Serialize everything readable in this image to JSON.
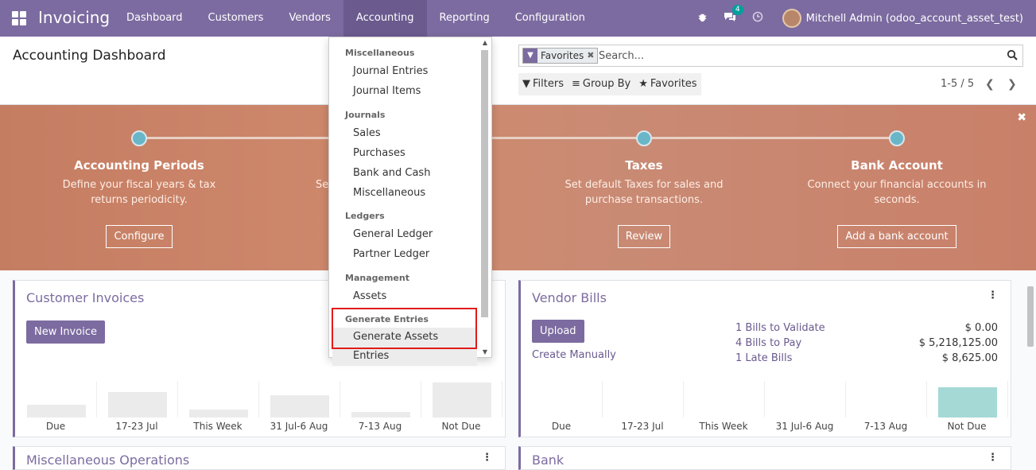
{
  "navbar": {
    "app_name": "Invoicing",
    "menu": [
      "Dashboard",
      "Customers",
      "Vendors",
      "Accounting",
      "Reporting",
      "Configuration"
    ],
    "active_menu": "Accounting",
    "messages_count": "4",
    "user": "Mitchell Admin (odoo_account_asset_test)"
  },
  "control": {
    "title": "Accounting Dashboard",
    "facet_label": "Favorites",
    "search_placeholder": "Search...",
    "filters": "Filters",
    "group_by": "Group By",
    "favorites": "Favorites",
    "pager": "1-5 / 5"
  },
  "banner": {
    "steps": [
      {
        "title": "Accounting Periods",
        "desc1": "Define your fiscal years & tax",
        "desc2": "returns periodicity.",
        "button": "Configure"
      },
      {
        "title": "Taxes",
        "desc1": "Set default Taxes for sales and",
        "desc2": "purchase transactions.",
        "button": "Review"
      },
      {
        "title": "Bank Account",
        "desc1": "Connect your financial accounts in",
        "desc2": "seconds.",
        "button": "Add a bank account"
      }
    ],
    "partial_left": "Se"
  },
  "dropdown": {
    "sections": [
      {
        "header": "Miscellaneous",
        "items": [
          "Journal Entries",
          "Journal Items"
        ]
      },
      {
        "header": "Journals",
        "items": [
          "Sales",
          "Purchases",
          "Bank and Cash",
          "Miscellaneous"
        ]
      },
      {
        "header": "Ledgers",
        "items": [
          "General Ledger",
          "Partner Ledger"
        ]
      },
      {
        "header": "Management",
        "items": [
          "Assets"
        ]
      },
      {
        "header": "Generate Entries",
        "items": [
          "Generate Assets Entries"
        ]
      }
    ]
  },
  "customer_invoices": {
    "title": "Customer Invoices",
    "button": "New Invoice",
    "graph_labels": [
      "Due",
      "17-23 Jul",
      "This Week",
      "31 Jul-6 Aug",
      "7-13 Aug",
      "Not Due"
    ]
  },
  "vendor_bills": {
    "title": "Vendor Bills",
    "button": "Upload",
    "link": "Create Manually",
    "stats": [
      {
        "label": "1 Bills to Validate",
        "value": "$ 0.00"
      },
      {
        "label": "4 Bills to Pay",
        "value": "$ 5,218,125.00"
      },
      {
        "label": "1 Late Bills",
        "value": "$ 8,625.00"
      }
    ],
    "graph_labels": [
      "Due",
      "17-23 Jul",
      "This Week",
      "31 Jul-6 Aug",
      "7-13 Aug",
      "Not Due"
    ]
  },
  "lower_cards": {
    "left_title": "Miscellaneous Operations",
    "right_title": "Bank"
  },
  "colors": {
    "brand": "#7c6ba0",
    "accent_teal": "#a4d9d5",
    "banner": "#c8826a",
    "highlight": "#e01b1b"
  }
}
